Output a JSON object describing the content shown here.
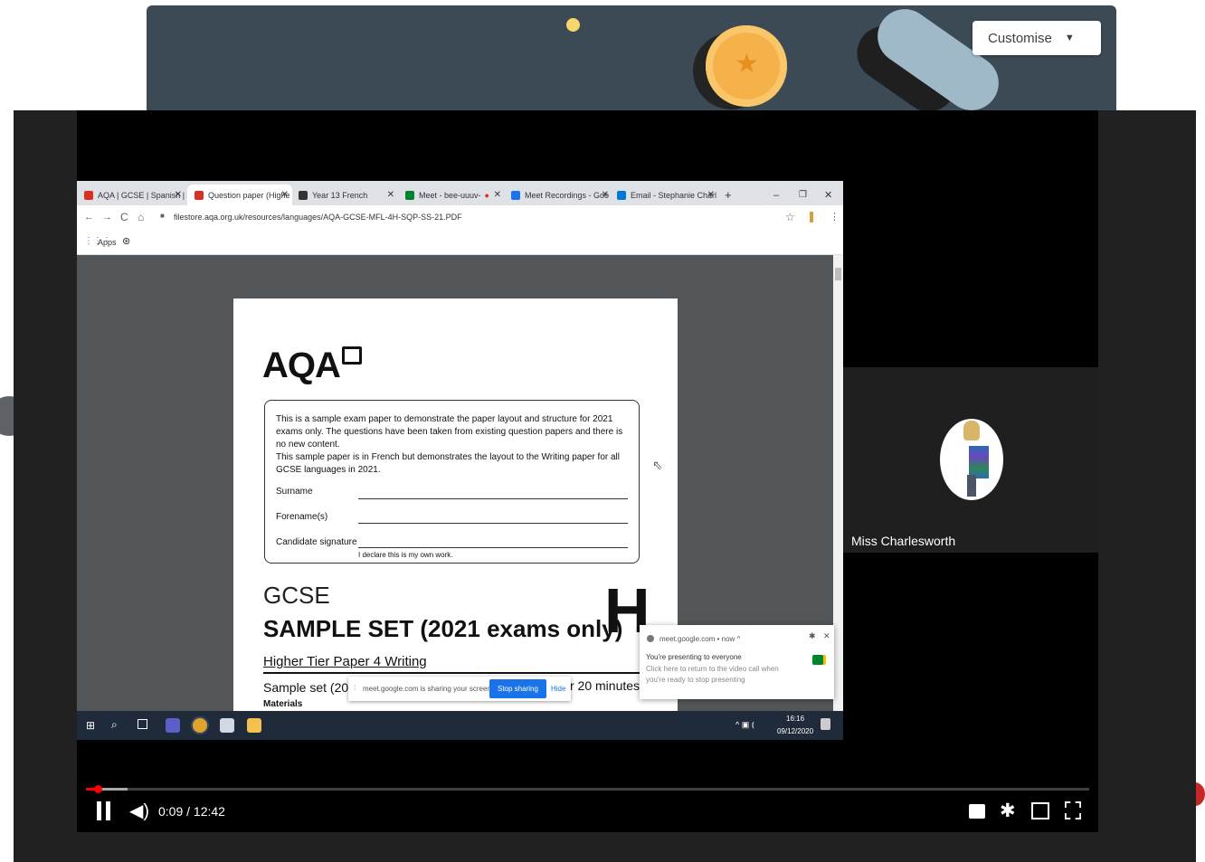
{
  "classroom": {
    "customise_label": "Customise"
  },
  "browser": {
    "tabs": [
      {
        "label": "AQA | GCSE | Spanish |",
        "color": "#d93025"
      },
      {
        "label": "Question paper (Highe",
        "color": "#d93025",
        "active": true
      },
      {
        "label": "Year 13 French",
        "color": "#333333"
      },
      {
        "label": "Meet - bee-uuuv-",
        "color": "#00832d"
      },
      {
        "label": "Meet Recordings - Goo",
        "color": "#1a73e8"
      },
      {
        "label": "Email - Stephanie Charl",
        "color": "#0078d4"
      }
    ],
    "new_tab": "+",
    "window_controls": {
      "minimize": "–",
      "restore": "❐",
      "close": "✕"
    },
    "address": "filestore.aqa.org.uk/resources/languages/AQA-GCSE-MFL-4H-SQP-SS-21.PDF",
    "bookmarks": {
      "apps": "Apps"
    }
  },
  "pdf": {
    "logo": "AQA",
    "intro": "This is a sample exam paper to demonstrate the paper layout and structure for 2021 exams only. The questions have been taken from existing question papers and there is no new content.",
    "intro2": "This sample paper is in French but demonstrates the layout to the Writing paper for all GCSE languages in 2021.",
    "surname": "Surname",
    "forenames": "Forename(s)",
    "signature": "Candidate signature",
    "declaration": "I declare this is my own work.",
    "gcse": "GCSE",
    "sample_set": "SAMPLE SET (2021 exams only)",
    "tier": "Higher Tier  Paper 4  Writing",
    "h_mark": "H",
    "sample_line": "Sample set (2021",
    "time": "r 20 minutes",
    "materials": "Materials"
  },
  "notification": {
    "source": "meet.google.com • now ^",
    "title": "You're presenting to everyone",
    "body": "Click here to return to the video call when you're ready to stop presenting"
  },
  "sharebar": {
    "text": "meet.google.com is sharing your screen.",
    "stop": "Stop sharing",
    "hide": "Hide"
  },
  "taskbar": {
    "time": "16:16",
    "date": "09/12/2020"
  },
  "participant": {
    "name": "Miss Charlesworth"
  },
  "player": {
    "time": "0:09 / 12:42",
    "progress": 0.012,
    "icons": [
      "pause-icon",
      "volume-icon",
      "subtitles-icon",
      "settings-icon",
      "miniplayer-icon",
      "fullscreen-icon"
    ]
  }
}
